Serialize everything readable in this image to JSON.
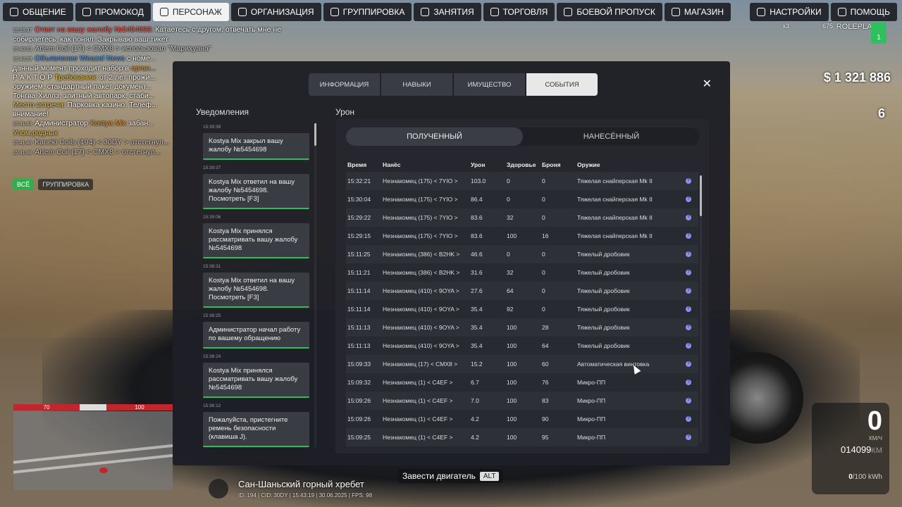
{
  "topbar": {
    "left": [
      {
        "label": "ОБЩЕНИЕ",
        "icon": "chat-icon"
      },
      {
        "label": "ПРОМОКОД",
        "icon": "person-icon"
      },
      {
        "label": "ПЕРСОНАЖ",
        "icon": "user-circle-icon",
        "active": true
      },
      {
        "label": "ОРГАНИЗАЦИЯ",
        "icon": "organization-icon"
      },
      {
        "label": "ГРУППИРОВКА",
        "icon": "group-icon"
      },
      {
        "label": "ЗАНЯТИЯ",
        "icon": "list-icon"
      },
      {
        "label": "ТОРГОВЛЯ",
        "icon": "chart-icon"
      },
      {
        "label": "БОЕВОЙ ПРОПУСК",
        "icon": "gear-icon"
      },
      {
        "label": "МАГАЗИН",
        "icon": "cart-icon"
      }
    ],
    "right": [
      {
        "label": "НАСТРОЙКИ",
        "icon": "settings-icon"
      },
      {
        "label": "ПОМОЩЬ",
        "icon": "help-icon"
      }
    ]
  },
  "chat": {
    "lines": [
      {
        "time": "15:39:37",
        "parts": [
          {
            "c": "red",
            "t": "Ответ на вашу жалобу №5454698:"
          },
          {
            "c": "",
            "t": " Катаетесь с другом, отвечать мне не"
          }
        ]
      },
      {
        "time": "",
        "parts": [
          {
            "c": "",
            "t": "собираетесь, как понял. Закрываю ваш тикет"
          }
        ]
      },
      {
        "time": "15:40:03",
        "parts": [
          {
            "c": "gray",
            "t": "Artem Coil (17) < CMX8 > использовал \"Марихуана\""
          }
        ]
      },
      {
        "time": "15:40:09",
        "parts": [
          {
            "c": "blue",
            "t": "Объявление Weazel News"
          },
          {
            "c": "",
            "t": " с номе..."
          }
        ]
      },
      {
        "time": "",
        "parts": [
          {
            "c": "",
            "t": "данный момент проходит набор в "
          },
          {
            "c": "orange",
            "t": "орган..."
          }
        ]
      },
      {
        "time": "",
        "parts": [
          {
            "c": "",
            "t": "Р А К Т О Р "
          },
          {
            "c": "ylw",
            "t": "Требования:"
          },
          {
            "c": "",
            "t": " от 2 лет прожи..."
          }
        ]
      },
      {
        "time": "",
        "parts": [
          {
            "c": "",
            "t": "оружием, стандартный пакет документ..."
          }
        ]
      },
      {
        "time": "",
        "parts": [
          {
            "c": "",
            "t": "Тонгва-Хиллз, элитный автопарк, стаби..."
          }
        ]
      },
      {
        "time": "",
        "parts": [
          {
            "c": "ylw",
            "t": "Место встречи:"
          },
          {
            "c": "",
            "t": " Парковка казино. Телеф..."
          }
        ]
      },
      {
        "time": "",
        "parts": [
          {
            "c": "",
            "t": "внимание!"
          }
        ]
      },
      {
        "time": "15:41:43",
        "parts": [
          {
            "c": "",
            "t": "Администратор "
          },
          {
            "c": "orange",
            "t": "Kostya Mix"
          },
          {
            "c": "",
            "t": " забан..."
          }
        ]
      },
      {
        "time": "",
        "parts": [
          {
            "c": "ylw",
            "t": "Упом.родных"
          }
        ]
      },
      {
        "time": "15:41:46",
        "parts": [
          {
            "c": "gray",
            "t": "Kaneki Coils (194) < 30DY > отстегнул..."
          }
        ]
      },
      {
        "time": "15:41:48",
        "parts": [
          {
            "c": "gray",
            "t": "Artem Coil (17) < CMX8 > отстегнул..."
          }
        ]
      }
    ],
    "btn_all": "ВСЁ",
    "btn_group": "ГРУППИРОВКА"
  },
  "hud": {
    "money": "$ 1 321 886",
    "online": "6",
    "brand": "ROLEPLAY",
    "badge": "1",
    "chip_x3": "x3",
    "chip_675": "675"
  },
  "health": {
    "hp_left": "70",
    "hp_right": "100"
  },
  "location": {
    "name": "Сан-Шаньский горный хребет",
    "sub": "ID: 194 | CID: 30DY | 15:43:19 | 30.06.2025 | FPS: 98"
  },
  "engine": {
    "label": "Завести двигатель",
    "key": "ALT"
  },
  "speedo": {
    "speed": "0",
    "unit": "КМ/Ч",
    "odo": "014099",
    "odo_unit": "КМ",
    "kwh": "0",
    "kwh_unit": "/100 kWh"
  },
  "modal": {
    "tabs": [
      {
        "label": "ИНФОРМАЦИЯ"
      },
      {
        "label": "НАВЫКИ"
      },
      {
        "label": "ИМУЩЕСТВО"
      },
      {
        "label": "СОБЫТИЯ",
        "active": true
      }
    ],
    "notif_title": "Уведомления",
    "notifications": [
      {
        "time": "15:39:39",
        "text": "Kostya Mix закрыл вашу жалобу №5454698"
      },
      {
        "time": "15:39:37",
        "text": "Kostya Mix ответил на вашу жалобу №5454698. Посмотреть [F3]"
      },
      {
        "time": "15:39:06",
        "text": "Kostya Mix принялся рассматривать вашу жалобу №5454698"
      },
      {
        "time": "15:38:31",
        "text": "Kostya Mix ответил на вашу жалобу №5454698. Посмотреть [F3]"
      },
      {
        "time": "15:38:25",
        "text": "Администратор начал работу по вашему обращению"
      },
      {
        "time": "15:38:24",
        "text": "Kostya Mix принялся рассматривать вашу жалобу №5454698"
      },
      {
        "time": "15:38:12",
        "text": "Пожалуйста, пристегните ремень безопасности (клавиша J)."
      }
    ],
    "damage_title": "Урон",
    "seg_received": "ПОЛУЧЕННЫЙ",
    "seg_dealt": "НАНЕСЁННЫЙ",
    "columns": {
      "time": "Время",
      "by": "Нанёс",
      "dmg": "Урон",
      "hp": "Здоровье",
      "armor": "Броня",
      "weapon": "Оружие"
    },
    "rows": [
      {
        "time": "15:32:21",
        "by": "Незнакомец (175) < 7YIO >",
        "dmg": "103.0",
        "hp": "0",
        "armor": "0",
        "weapon": "Тяжелая снайперская Mk II"
      },
      {
        "time": "15:30:04",
        "by": "Незнакомец (175) < 7YIO >",
        "dmg": "86.4",
        "hp": "0",
        "armor": "0",
        "weapon": "Тяжелая снайперская Mk II"
      },
      {
        "time": "15:29:22",
        "by": "Незнакомец (175) < 7YIO >",
        "dmg": "83.6",
        "hp": "32",
        "armor": "0",
        "weapon": "Тяжелая снайперская Mk II"
      },
      {
        "time": "15:29:15",
        "by": "Незнакомец (175) < 7YIO >",
        "dmg": "83.6",
        "hp": "100",
        "armor": "16",
        "weapon": "Тяжелая снайперская Mk II"
      },
      {
        "time": "15:11:25",
        "by": "Незнакомец (386) < B2HK >",
        "dmg": "46.6",
        "hp": "0",
        "armor": "0",
        "weapon": "Тяжелый дробовик"
      },
      {
        "time": "15:11:21",
        "by": "Незнакомец (386) < B2HK >",
        "dmg": "31.6",
        "hp": "32",
        "armor": "0",
        "weapon": "Тяжелый дробовик"
      },
      {
        "time": "15:11:14",
        "by": "Незнакомец (410) < 9OYA >",
        "dmg": "27.6",
        "hp": "64",
        "armor": "0",
        "weapon": "Тяжелый дробовик"
      },
      {
        "time": "15:11:14",
        "by": "Незнакомец (410) < 9OYA >",
        "dmg": "35.4",
        "hp": "92",
        "armor": "0",
        "weapon": "Тяжелый дробовик"
      },
      {
        "time": "15:11:13",
        "by": "Незнакомец (410) < 9OYA >",
        "dmg": "35.4",
        "hp": "100",
        "armor": "28",
        "weapon": "Тяжелый дробовик"
      },
      {
        "time": "15:11:13",
        "by": "Незнакомец (410) < 9OYA >",
        "dmg": "35.4",
        "hp": "100",
        "armor": "64",
        "weapon": "Тяжелый дробовик"
      },
      {
        "time": "15:09:33",
        "by": "Незнакомец (17) < CMX8 >",
        "dmg": "15.2",
        "hp": "100",
        "armor": "60",
        "weapon": "Автоматическая винтовка"
      },
      {
        "time": "15:09:32",
        "by": "Незнакомец (1) < C4EF >",
        "dmg": "6.7",
        "hp": "100",
        "armor": "76",
        "weapon": "Микро-ПП"
      },
      {
        "time": "15:09:26",
        "by": "Незнакомец (1) < C4EF >",
        "dmg": "7.0",
        "hp": "100",
        "armor": "83",
        "weapon": "Микро-ПП"
      },
      {
        "time": "15:09:26",
        "by": "Незнакомец (1) < C4EF >",
        "dmg": "4.2",
        "hp": "100",
        "armor": "90",
        "weapon": "Микро-ПП"
      },
      {
        "time": "15:09:25",
        "by": "Незнакомец (1) < C4EF >",
        "dmg": "4.2",
        "hp": "100",
        "armor": "95",
        "weapon": "Микро-ПП"
      }
    ]
  }
}
